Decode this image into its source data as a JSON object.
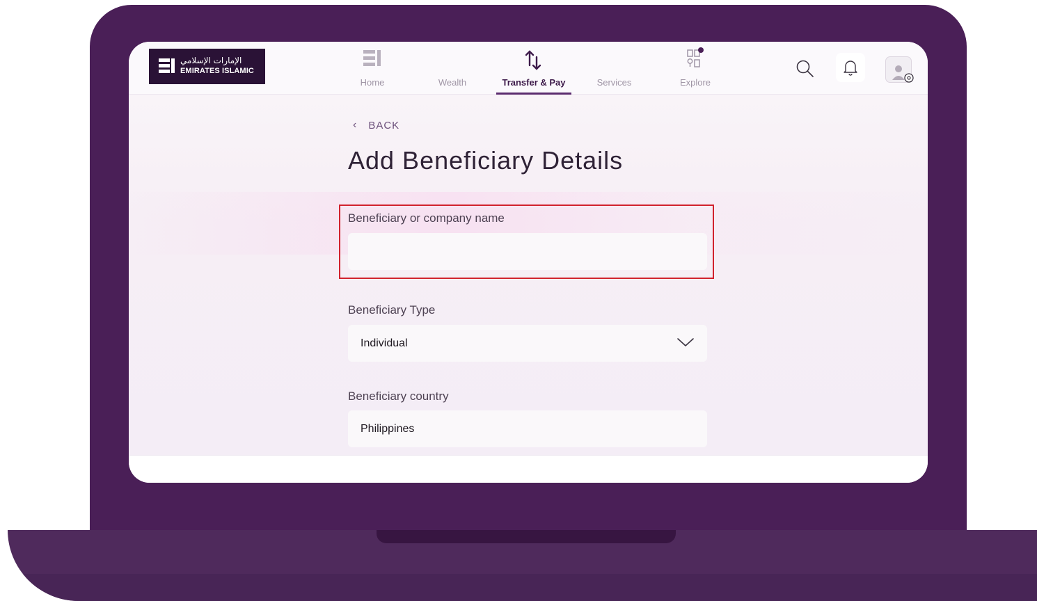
{
  "brand": {
    "name_ar": "الإمارات الإسلامي",
    "name_en": "EMIRATES ISLAMIC"
  },
  "nav": {
    "items": [
      {
        "label": "Home",
        "icon": "home-bars-icon"
      },
      {
        "label": "Wealth",
        "icon": ""
      },
      {
        "label": "Transfer & Pay",
        "icon": "transfer-arrows-icon",
        "active": true
      },
      {
        "label": "Services",
        "icon": ""
      },
      {
        "label": "Explore",
        "icon": "explore-grid-icon"
      }
    ]
  },
  "header_actions": {
    "search_icon": "search-icon",
    "notifications_icon": "bell-icon",
    "profile_icon": "profile-settings-icon"
  },
  "page": {
    "back_label": "BACK",
    "title": "Add Beneficiary Details"
  },
  "form": {
    "name_field": {
      "label": "Beneficiary or company name",
      "value": "",
      "placeholder": ""
    },
    "type_field": {
      "label": "Beneficiary Type",
      "value": "Individual"
    },
    "country_field": {
      "label": "Beneficiary country",
      "value": "Philippines"
    }
  },
  "colors": {
    "laptop_frame": "#4a1f57",
    "brand_dark": "#2a1236",
    "accent": "#5b2b6e",
    "highlight": "#d1222d"
  }
}
